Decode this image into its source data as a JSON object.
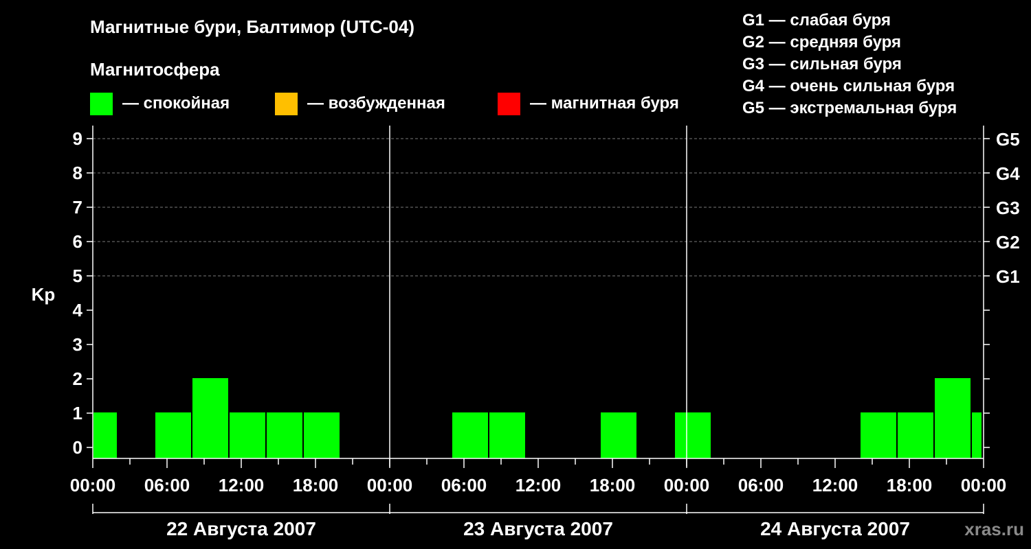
{
  "header": {
    "title": "Магнитные бури, Балтимор (UTC-04)",
    "subtitle": "Магнитосфера",
    "legend": [
      {
        "label": "— спокойная",
        "color": "#00ff00"
      },
      {
        "label": "— возбужденная",
        "color": "#ffbf00"
      },
      {
        "label": "— магнитная буря",
        "color": "#ff0000"
      }
    ],
    "storm_scale": [
      "G1 — слабая буря",
      "G2 — средняя буря",
      "G3 — сильная буря",
      "G4 — очень сильная буря",
      "G5 — экстремальная буря"
    ]
  },
  "watermark": "xras.ru",
  "chart_data": {
    "type": "bar",
    "ylabel": "Kp",
    "ylim": [
      0,
      9
    ],
    "y_ticks": [
      "0",
      "1",
      "2",
      "3",
      "4",
      "5",
      "6",
      "7",
      "8",
      "9"
    ],
    "right_ticks": [
      {
        "kp": 5,
        "label": "G1"
      },
      {
        "kp": 6,
        "label": "G2"
      },
      {
        "kp": 7,
        "label": "G3"
      },
      {
        "kp": 8,
        "label": "G4"
      },
      {
        "kp": 9,
        "label": "G5"
      }
    ],
    "x_tick_labels": [
      "00:00",
      "06:00",
      "12:00",
      "18:00",
      "00:00",
      "06:00",
      "12:00",
      "18:00",
      "00:00",
      "06:00",
      "12:00",
      "18:00",
      "00:00"
    ],
    "days": [
      "22 Августа 2007",
      "23 Августа 2007",
      "24 Августа 2007"
    ],
    "grid": "dashed at Kp 5–9",
    "color_quiet": "#00ff00",
    "bars": [
      {
        "day": 0,
        "start_hour": 0,
        "end_hour": 2,
        "kp": 1
      },
      {
        "day": 0,
        "start_hour": 5,
        "end_hour": 8,
        "kp": 1
      },
      {
        "day": 0,
        "start_hour": 8,
        "end_hour": 11,
        "kp": 2
      },
      {
        "day": 0,
        "start_hour": 11,
        "end_hour": 14,
        "kp": 1
      },
      {
        "day": 0,
        "start_hour": 14,
        "end_hour": 17,
        "kp": 1
      },
      {
        "day": 0,
        "start_hour": 17,
        "end_hour": 20,
        "kp": 1
      },
      {
        "day": 1,
        "start_hour": 5,
        "end_hour": 8,
        "kp": 1
      },
      {
        "day": 1,
        "start_hour": 8,
        "end_hour": 11,
        "kp": 1
      },
      {
        "day": 1,
        "start_hour": 17,
        "end_hour": 20,
        "kp": 1
      },
      {
        "day": 1,
        "start_hour": 23,
        "end_hour": 26,
        "kp": 1
      },
      {
        "day": 2,
        "start_hour": 14,
        "end_hour": 17,
        "kp": 1
      },
      {
        "day": 2,
        "start_hour": 17,
        "end_hour": 20,
        "kp": 1
      },
      {
        "day": 2,
        "start_hour": 20,
        "end_hour": 23,
        "kp": 2
      },
      {
        "day": 2,
        "start_hour": 23,
        "end_hour": 24,
        "kp": 1
      }
    ]
  }
}
